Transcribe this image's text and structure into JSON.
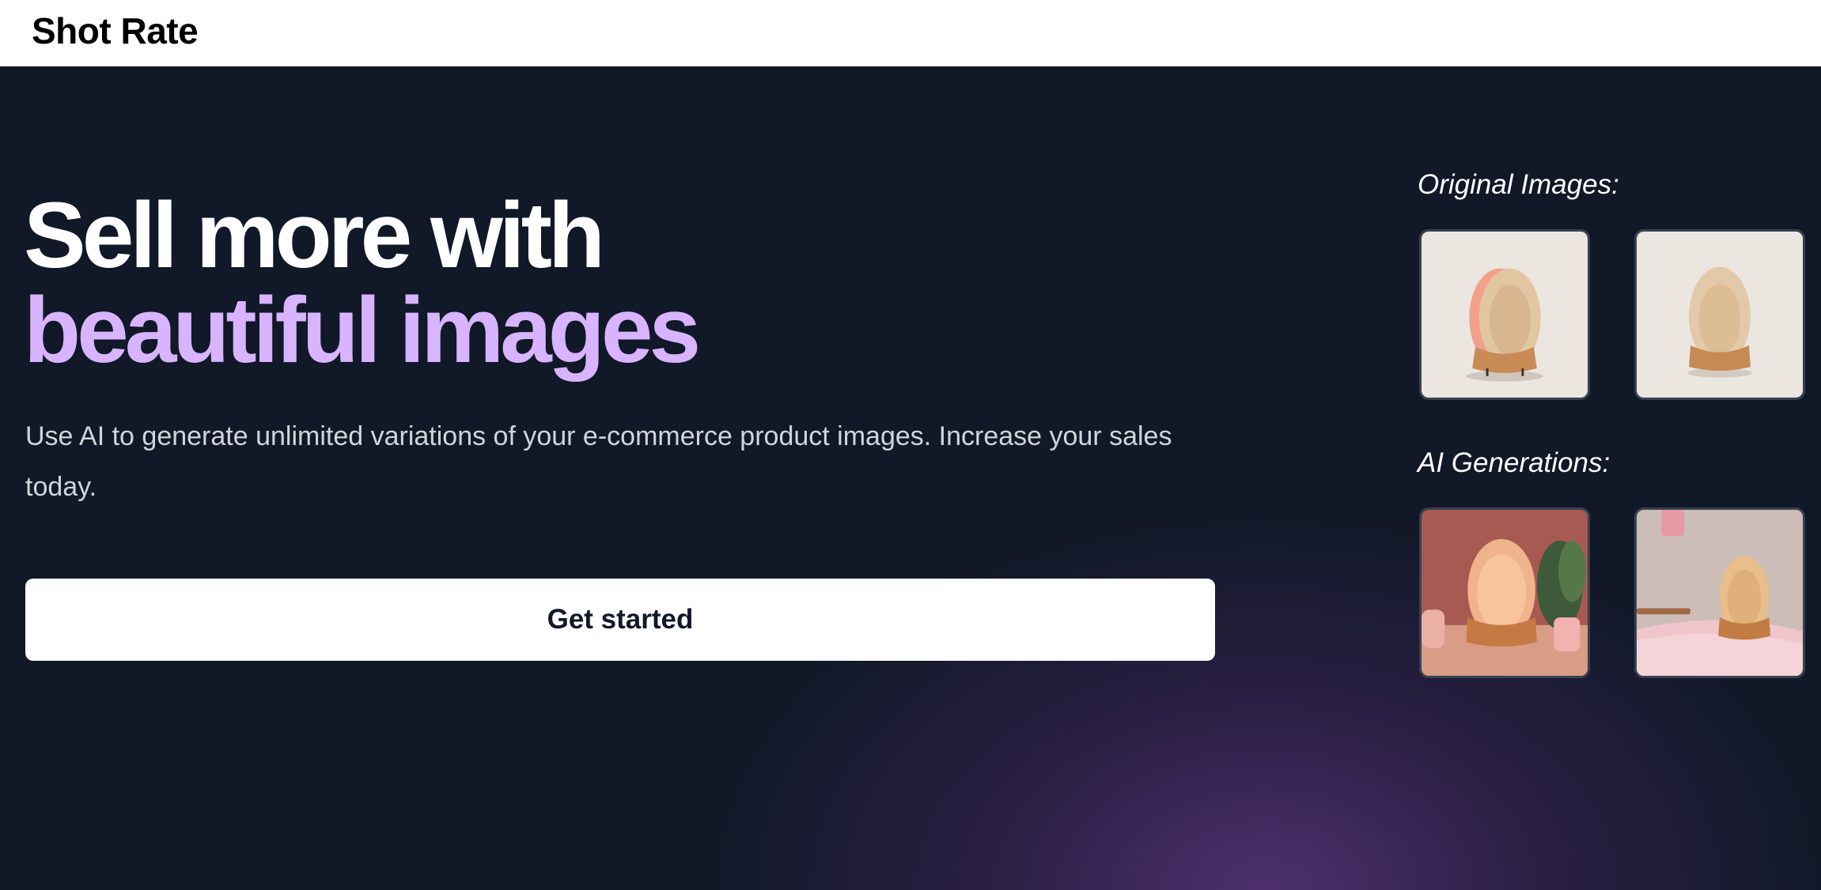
{
  "header": {
    "brand": "Shot Rate"
  },
  "hero": {
    "headline_line1": "Sell more with",
    "headline_line2": "beautiful images",
    "subtitle": "Use AI to generate unlimited variations of your e-commerce product images. Increase your sales today.",
    "cta_label": "Get started"
  },
  "showcase": {
    "original_label": "Original Images:",
    "ai_label": "AI Generations:",
    "images": [
      {
        "group": "original",
        "subject": "wooden oval lamp with pink glow on beige background"
      },
      {
        "group": "original",
        "subject": "wooden oval lamp on beige background"
      },
      {
        "group": "ai",
        "subject": "glowing wooden oval lamp on table with plant"
      },
      {
        "group": "ai",
        "subject": "wooden oval lamp on pink bed"
      }
    ]
  },
  "colors": {
    "background": "#111827",
    "accent_purple": "#d8b4fe",
    "header_bg": "#ffffff",
    "subtitle_text": "#d1d5db"
  }
}
